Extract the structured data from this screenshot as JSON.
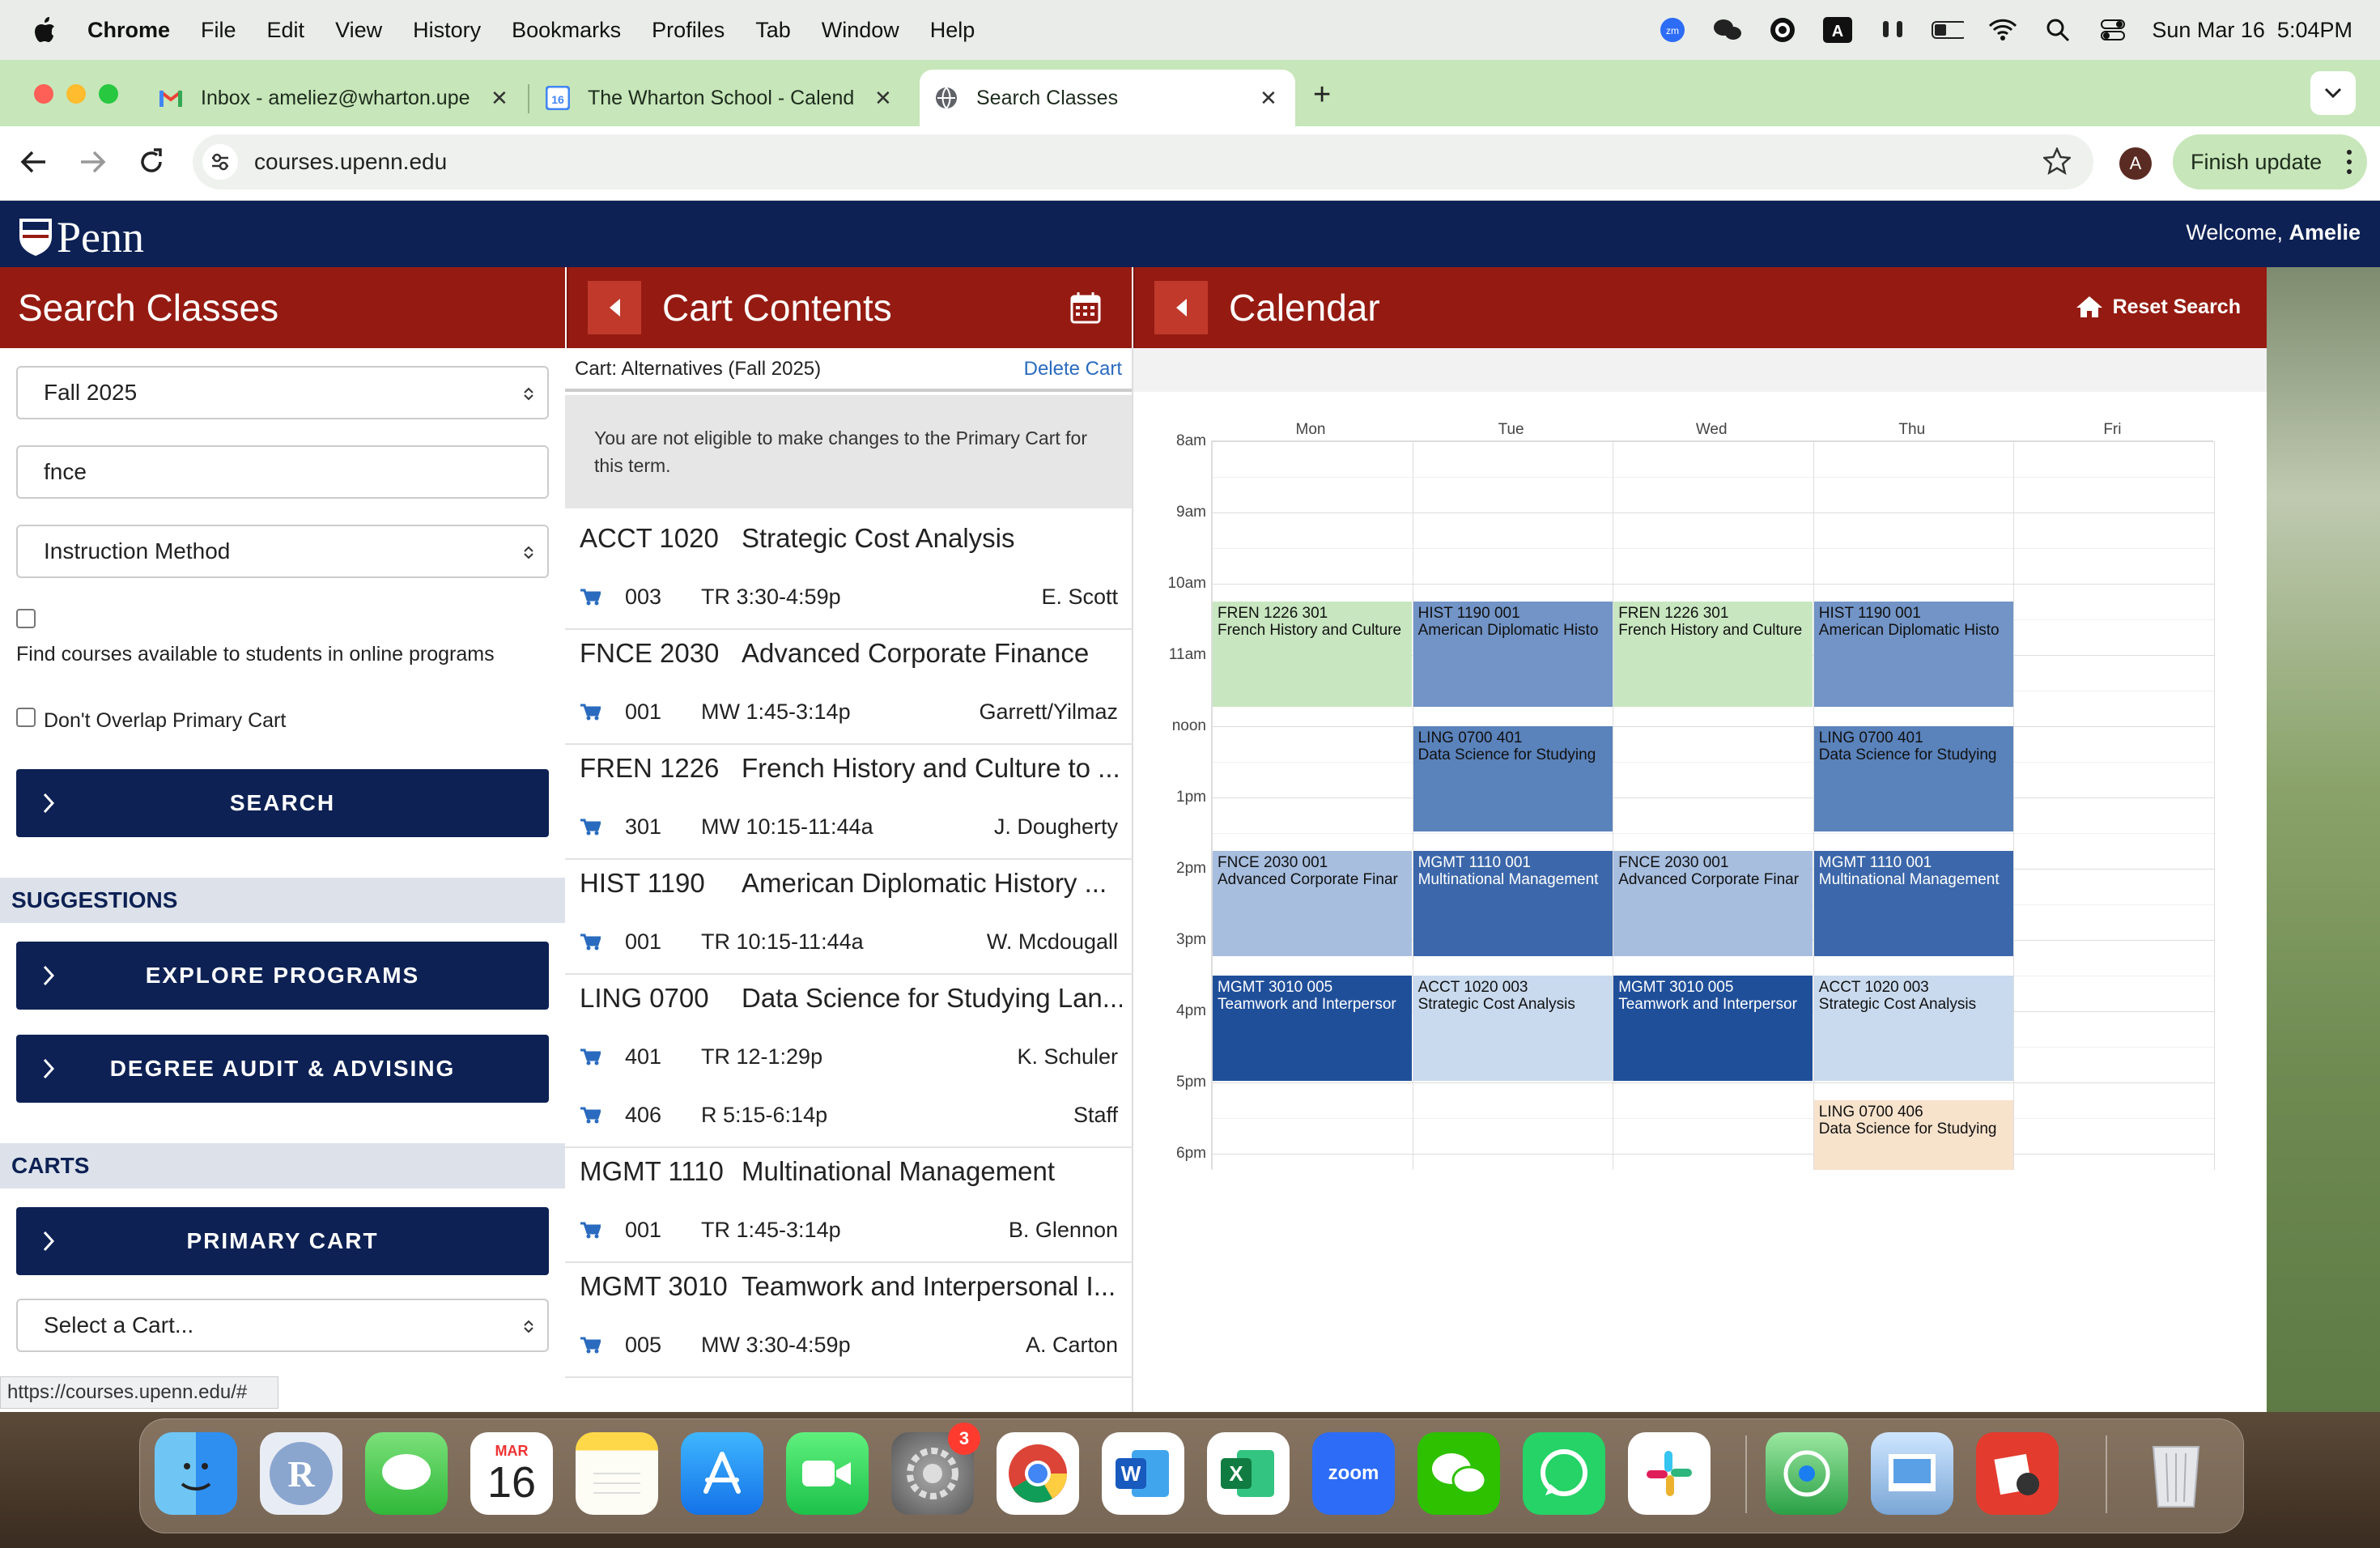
{
  "menubar": {
    "app": "Chrome",
    "items": [
      "File",
      "Edit",
      "View",
      "History",
      "Bookmarks",
      "Profiles",
      "Tab",
      "Window",
      "Help"
    ],
    "datetime": "Sun Mar 16  5:04PM",
    "badge_a": "A"
  },
  "tabs": [
    {
      "title": "Inbox - ameliez@wharton.upe"
    },
    {
      "title": "The Wharton School - Calend",
      "badge": "16"
    },
    {
      "title": "Search Classes"
    }
  ],
  "toolbar": {
    "url": "courses.upenn.edu",
    "profile_initial": "A",
    "finish_label": "Finish update"
  },
  "penn": {
    "logo": "Penn",
    "welcome_prefix": "Welcome, ",
    "welcome_name": "Amelie"
  },
  "search": {
    "title": "Search Classes",
    "term": "Fall 2025",
    "query": "fnce",
    "instruction": "Instruction Method",
    "online_label": "Find courses available to students in online programs",
    "overlap_label": "Don't Overlap Primary Cart",
    "search_btn": "SEARCH",
    "suggestions": "SUGGESTIONS",
    "explore": "EXPLORE PROGRAMS",
    "audit": "DEGREE AUDIT & ADVISING",
    "carts": "CARTS",
    "primary": "PRIMARY CART",
    "select_cart": "Select a Cart..."
  },
  "cart": {
    "title": "Cart Contents",
    "name": "Cart: Alternatives (Fall 2025)",
    "delete": "Delete Cart",
    "notice": "You are not eligible to make changes to the Primary Cart for this term.",
    "courses": [
      {
        "code": "ACCT 1020",
        "name": "Strategic Cost Analysis",
        "sections": [
          {
            "sec": "003",
            "time": "TR 3:30-4:59p",
            "instr": "E. Scott"
          }
        ]
      },
      {
        "code": "FNCE 2030",
        "name": "Advanced Corporate Finance",
        "sections": [
          {
            "sec": "001",
            "time": "MW 1:45-3:14p",
            "instr": "Garrett/Yilmaz"
          }
        ]
      },
      {
        "code": "FREN 1226",
        "name": "French History and Culture to ...",
        "sections": [
          {
            "sec": "301",
            "time": "MW 10:15-11:44a",
            "instr": "J. Dougherty"
          }
        ]
      },
      {
        "code": "HIST 1190",
        "name": "American Diplomatic History ...",
        "sections": [
          {
            "sec": "001",
            "time": "TR 10:15-11:44a",
            "instr": "W. Mcdougall"
          }
        ]
      },
      {
        "code": "LING 0700",
        "name": "Data Science for Studying Lan...",
        "sections": [
          {
            "sec": "401",
            "time": "TR 12-1:29p",
            "instr": "K. Schuler"
          },
          {
            "sec": "406",
            "time": "R 5:15-6:14p",
            "instr": "Staff"
          }
        ]
      },
      {
        "code": "MGMT 1110",
        "name": "Multinational Management",
        "sections": [
          {
            "sec": "001",
            "time": "TR 1:45-3:14p",
            "instr": "B. Glennon"
          }
        ]
      },
      {
        "code": "MGMT 3010",
        "name": "Teamwork and Interpersonal I...",
        "sections": [
          {
            "sec": "005",
            "time": "MW 3:30-4:59p",
            "instr": "A. Carton"
          }
        ]
      }
    ]
  },
  "calendar": {
    "title": "Calendar",
    "reset": "Reset Search",
    "days": [
      "Mon",
      "Tue",
      "Wed",
      "Thu",
      "Fri"
    ],
    "hours": [
      "8am",
      "9am",
      "10am",
      "11am",
      "noon",
      "1pm",
      "2pm",
      "3pm",
      "4pm",
      "5pm",
      "6pm"
    ],
    "events": [
      {
        "day": 0,
        "start": 10.25,
        "end": 11.75,
        "l1": "FREN 1226 301",
        "l2": "French History and Culture",
        "bg": "#c8e6c0"
      },
      {
        "day": 2,
        "start": 10.25,
        "end": 11.75,
        "l1": "FREN 1226 301",
        "l2": "French History and Culture",
        "bg": "#c8e6c0"
      },
      {
        "day": 1,
        "start": 10.25,
        "end": 11.75,
        "l1": "HIST 1190 001",
        "l2": "American Diplomatic Histo",
        "bg": "#7294c6"
      },
      {
        "day": 3,
        "start": 10.25,
        "end": 11.75,
        "l1": "HIST 1190 001",
        "l2": "American Diplomatic Histo",
        "bg": "#7294c6"
      },
      {
        "day": 1,
        "start": 12.0,
        "end": 13.5,
        "l1": "LING 0700 401",
        "l2": "Data Science for Studying",
        "bg": "#5a82bb"
      },
      {
        "day": 3,
        "start": 12.0,
        "end": 13.5,
        "l1": "LING 0700 401",
        "l2": "Data Science for Studying",
        "bg": "#5a82bb"
      },
      {
        "day": 0,
        "start": 13.75,
        "end": 15.25,
        "l1": "FNCE 2030 001",
        "l2": "Advanced Corporate Finar",
        "bg": "#a7bedf"
      },
      {
        "day": 2,
        "start": 13.75,
        "end": 15.25,
        "l1": "FNCE 2030 001",
        "l2": "Advanced Corporate Finar",
        "bg": "#a7bedf"
      },
      {
        "day": 1,
        "start": 13.75,
        "end": 15.25,
        "l1": "MGMT 1110 001",
        "l2": "Multinational Management",
        "bg": "#3c67aa",
        "fg": "#ffffff"
      },
      {
        "day": 3,
        "start": 13.75,
        "end": 15.25,
        "l1": "MGMT 1110 001",
        "l2": "Multinational Management",
        "bg": "#3c67aa",
        "fg": "#ffffff"
      },
      {
        "day": 0,
        "start": 15.5,
        "end": 17.0,
        "l1": "MGMT 3010 005",
        "l2": "Teamwork and Interpersor",
        "bg": "#204f9a",
        "fg": "#ffffff"
      },
      {
        "day": 2,
        "start": 15.5,
        "end": 17.0,
        "l1": "MGMT 3010 005",
        "l2": "Teamwork and Interpersor",
        "bg": "#204f9a",
        "fg": "#ffffff"
      },
      {
        "day": 1,
        "start": 15.5,
        "end": 17.0,
        "l1": "ACCT 1020 003",
        "l2": "Strategic Cost Analysis",
        "bg": "#c9daee"
      },
      {
        "day": 3,
        "start": 15.5,
        "end": 17.0,
        "l1": "ACCT 1020 003",
        "l2": "Strategic Cost Analysis",
        "bg": "#c9daee"
      },
      {
        "day": 3,
        "start": 17.25,
        "end": 18.25,
        "l1": "LING 0700 406",
        "l2": "Data Science for Studying",
        "bg": "#f7e2cc"
      }
    ]
  },
  "status_url": "https://courses.upenn.edu/#",
  "dock": {
    "cal_month": "MAR",
    "cal_day": "16",
    "settings_badge": "3",
    "zoom": "zoom",
    "r": "R"
  }
}
